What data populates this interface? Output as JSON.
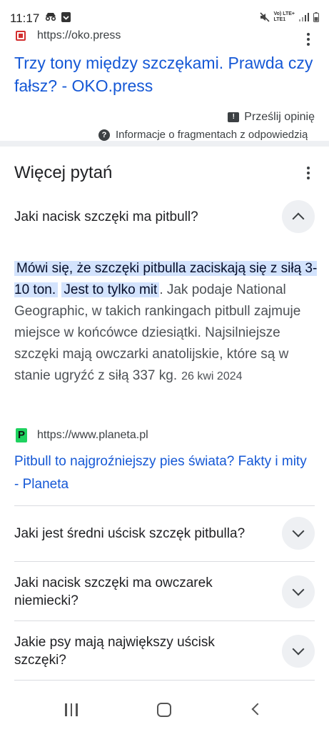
{
  "status_bar": {
    "time": "11:17",
    "network_line1": "Vo) LTE+",
    "network_line2": "LTE1",
    "icons": [
      "incognito-icon",
      "download-icon",
      "mute-icon",
      "signal-icon",
      "battery-icon"
    ]
  },
  "top_result": {
    "url": "https://oko.press",
    "title": "Trzy tony między szczękami. Prawda czy fałsz? - OKO.press",
    "feedback_label": "Prześlij opinię",
    "snippet_info_label": "Informacje o fragmentach z odpowiedzią"
  },
  "paa": {
    "title": "Więcej pytań",
    "expanded_question": "Jaki nacisk szczęki ma pitbull?",
    "answer": {
      "highlight1": "Mówi się, że szczęki pitbulla zaciskają się z siłą 3-10 ton.",
      "highlight2": "Jest to tylko mit",
      "rest": ". Jak podaje National Geographic, w takich rankingach pitbull zajmuje miejsce w końcówce dziesiątki. Najsilniejsze szczęki mają owczarki anatolijskie, które są w stanie ugryźć z siłą 337 kg.",
      "date": "26 kwi 2024"
    },
    "source_url": "https://www.planeta.pl",
    "source_title": "Pitbull to najgroźniejszy pies świata? Fakty i mity - Planeta",
    "questions": [
      "Jaki jest średni uścisk szczęk pitbulla?",
      "Jaki nacisk szczęki ma owczarek niemiecki?",
      "Jakie psy mają największy uścisk szczęki?"
    ]
  },
  "colors": {
    "link": "#1558d6",
    "highlight": "#d3e3fd",
    "divider": "#eef0f3",
    "planeta_favicon": "#1fd25f",
    "oko_favicon": "#d32f2f"
  }
}
